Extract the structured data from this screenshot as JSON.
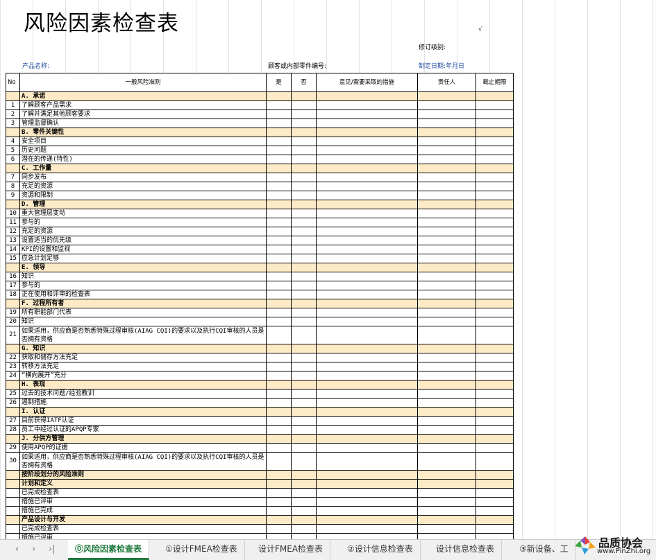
{
  "sheet": {
    "title": "风险因素检查表",
    "revision_label": "修订级别:",
    "checkmark": "√",
    "product_label": "产品名称:",
    "customer_part_label": "顾客或内部零件编号:",
    "date_label": "制定日期:年月日"
  },
  "table": {
    "headers": {
      "no": "No",
      "criteria": "一般风险准则",
      "yes": "是",
      "no_answer": "否",
      "opinion": "意见/需要采取的措施",
      "owner": "责任人",
      "deadline": "截止期限"
    },
    "rows": [
      {
        "type": "section",
        "text": "A. 承诺"
      },
      {
        "no": "1",
        "text": "了解顾客产品需求"
      },
      {
        "no": "2",
        "text": "了解并满足其他顾客要求"
      },
      {
        "no": "3",
        "text": "管理监督确认"
      },
      {
        "type": "section",
        "text": "B. 零件关键性"
      },
      {
        "no": "4",
        "text": "安全项目"
      },
      {
        "no": "5",
        "text": "历史问题"
      },
      {
        "no": "6",
        "text": "潜在的传递(特性)"
      },
      {
        "type": "section",
        "text": "C. 工作量"
      },
      {
        "no": "7",
        "text": "同步发布"
      },
      {
        "no": "8",
        "text": "充足的资源"
      },
      {
        "no": "9",
        "text": "资源和限制"
      },
      {
        "type": "section",
        "text": "D. 管理"
      },
      {
        "no": "10",
        "text": "重大管理层变动"
      },
      {
        "no": "11",
        "text": "参与的"
      },
      {
        "no": "12",
        "text": "充足的资源"
      },
      {
        "no": "13",
        "text": "设置适当的优先级"
      },
      {
        "no": "14",
        "text": "KPI的设置和监视"
      },
      {
        "no": "15",
        "text": "应急计划足够"
      },
      {
        "type": "section",
        "text": "E. 领导"
      },
      {
        "no": "16",
        "text": "知识"
      },
      {
        "no": "17",
        "text": "参与的"
      },
      {
        "no": "18",
        "text": "正在使用和评审的检查表"
      },
      {
        "type": "section",
        "text": "F. 过程所有者"
      },
      {
        "no": "19",
        "text": "所有职能部门代表"
      },
      {
        "no": "20",
        "text": "知识"
      },
      {
        "no": "21",
        "text": "如果适用，供应商是否熟悉特殊过程审核(AIAG CQI)的要求以及执行CQI审核的人员是否拥有资格",
        "tall": true
      },
      {
        "type": "section",
        "text": "G. 知识"
      },
      {
        "no": "22",
        "text": "获取和储存方法充足"
      },
      {
        "no": "23",
        "text": "转移方法充足"
      },
      {
        "no": "24",
        "text": "“横向展开”充分"
      },
      {
        "type": "section",
        "text": "H. 表现"
      },
      {
        "no": "25",
        "text": "过去的技术问题/经验教训"
      },
      {
        "no": "26",
        "text": "遏制措施"
      },
      {
        "type": "section",
        "text": "I. 认证"
      },
      {
        "no": "27",
        "text": "目前获得IATF认证"
      },
      {
        "no": "28",
        "text": "员工中经过认证的APQP专家"
      },
      {
        "type": "section",
        "text": "J. 分供方管理"
      },
      {
        "no": "29",
        "text": "使用APQP的证据"
      },
      {
        "no": "30",
        "text": "如果适用，供应商是否熟悉特殊过程审核(AIAG CQI)的要求以及执行CQI审核的人员是否拥有资格",
        "tall": true
      },
      {
        "type": "section",
        "text": "按阶段划分的风险准则"
      },
      {
        "type": "section",
        "text": "计划和定义"
      },
      {
        "no": "",
        "text": "已完成检查表"
      },
      {
        "no": "",
        "text": "措施已评审"
      },
      {
        "no": "",
        "text": "措施已完成"
      },
      {
        "type": "section",
        "text": "产品设计与开发"
      },
      {
        "no": "",
        "text": "已完成检查表"
      },
      {
        "no": "",
        "text": "措施已评审"
      }
    ]
  },
  "tabbar": {
    "tabs": [
      {
        "label": "⓪风险因素检查表",
        "active": true
      },
      {
        "label": "①设计FMEA检查表"
      },
      {
        "label": "设计FMEA检查表"
      },
      {
        "label": "②设计信息检查表"
      },
      {
        "label": "设计信息检查表"
      },
      {
        "label": "③新设备、工"
      }
    ]
  },
  "watermark": {
    "name": "品质协会",
    "url": "www.PinZhi.org"
  }
}
